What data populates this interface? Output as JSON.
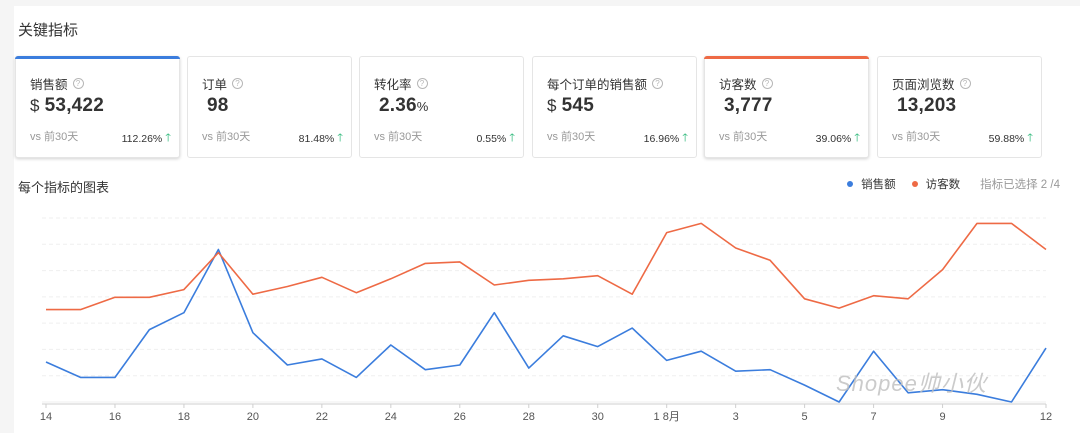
{
  "section_title": "关键指标",
  "metrics": [
    {
      "label": "销售额",
      "currency": "$",
      "value": "53,422",
      "suffix": "",
      "vs": "vs 前30天",
      "change": "112.26%",
      "selected": true,
      "accent": "#3b7ddd"
    },
    {
      "label": "订单",
      "currency": "",
      "value": "98",
      "suffix": "",
      "vs": "vs 前30天",
      "change": "81.48%",
      "selected": false,
      "accent": ""
    },
    {
      "label": "转化率",
      "currency": "",
      "value": "2.36",
      "suffix": "%",
      "vs": "vs 前30天",
      "change": "0.55%",
      "selected": false,
      "accent": ""
    },
    {
      "label": "每个订单的销售额",
      "currency": "$",
      "value": "545",
      "suffix": "",
      "vs": "vs 前30天",
      "change": "16.96%",
      "selected": false,
      "accent": ""
    },
    {
      "label": "访客数",
      "currency": "",
      "value": "3,777",
      "suffix": "",
      "vs": "vs 前30天",
      "change": "39.06%",
      "selected": true,
      "accent": "#ee6a45"
    },
    {
      "label": "页面浏览数",
      "currency": "",
      "value": "13,203",
      "suffix": "",
      "vs": "vs 前30天",
      "change": "59.88%",
      "selected": false,
      "accent": ""
    }
  ],
  "chart_title": "每个指标的图表",
  "legend": {
    "items": [
      {
        "name": "销售额",
        "color": "#3b7ddd"
      },
      {
        "name": "访客数",
        "color": "#ee6a45"
      }
    ],
    "selected_count": "指标已选择 2 /4"
  },
  "watermark": "Shopee帅小伙",
  "chart_data": {
    "type": "line",
    "x_tick_labels": [
      "14",
      "16",
      "18",
      "20",
      "22",
      "24",
      "26",
      "28",
      "30",
      "1 8月",
      "3",
      "5",
      "7",
      "9",
      "12"
    ],
    "title": "",
    "xlabel": "",
    "ylabel": "",
    "grid": true,
    "legend_position": "top-right",
    "series": [
      {
        "name": "销售额",
        "color": "#3b7ddd",
        "values": [
          0.26,
          0.16,
          0.16,
          0.47,
          0.58,
          0.99,
          0.45,
          0.24,
          0.28,
          0.16,
          0.37,
          0.21,
          0.24,
          0.58,
          0.22,
          0.43,
          0.36,
          0.48,
          0.27,
          0.33,
          0.2,
          0.21,
          0.11,
          0.0,
          0.33,
          0.06,
          0.08,
          0.05,
          0.0,
          0.35
        ]
      },
      {
        "name": "访客数",
        "color": "#ee6a45",
        "values": [
          0.6,
          0.6,
          0.68,
          0.68,
          0.73,
          0.97,
          0.7,
          0.75,
          0.81,
          0.71,
          0.8,
          0.9,
          0.91,
          0.76,
          0.79,
          0.8,
          0.82,
          0.7,
          1.1,
          1.16,
          1.0,
          0.92,
          0.67,
          0.61,
          0.69,
          0.67,
          0.86,
          1.16,
          1.16,
          0.99
        ]
      }
    ]
  }
}
